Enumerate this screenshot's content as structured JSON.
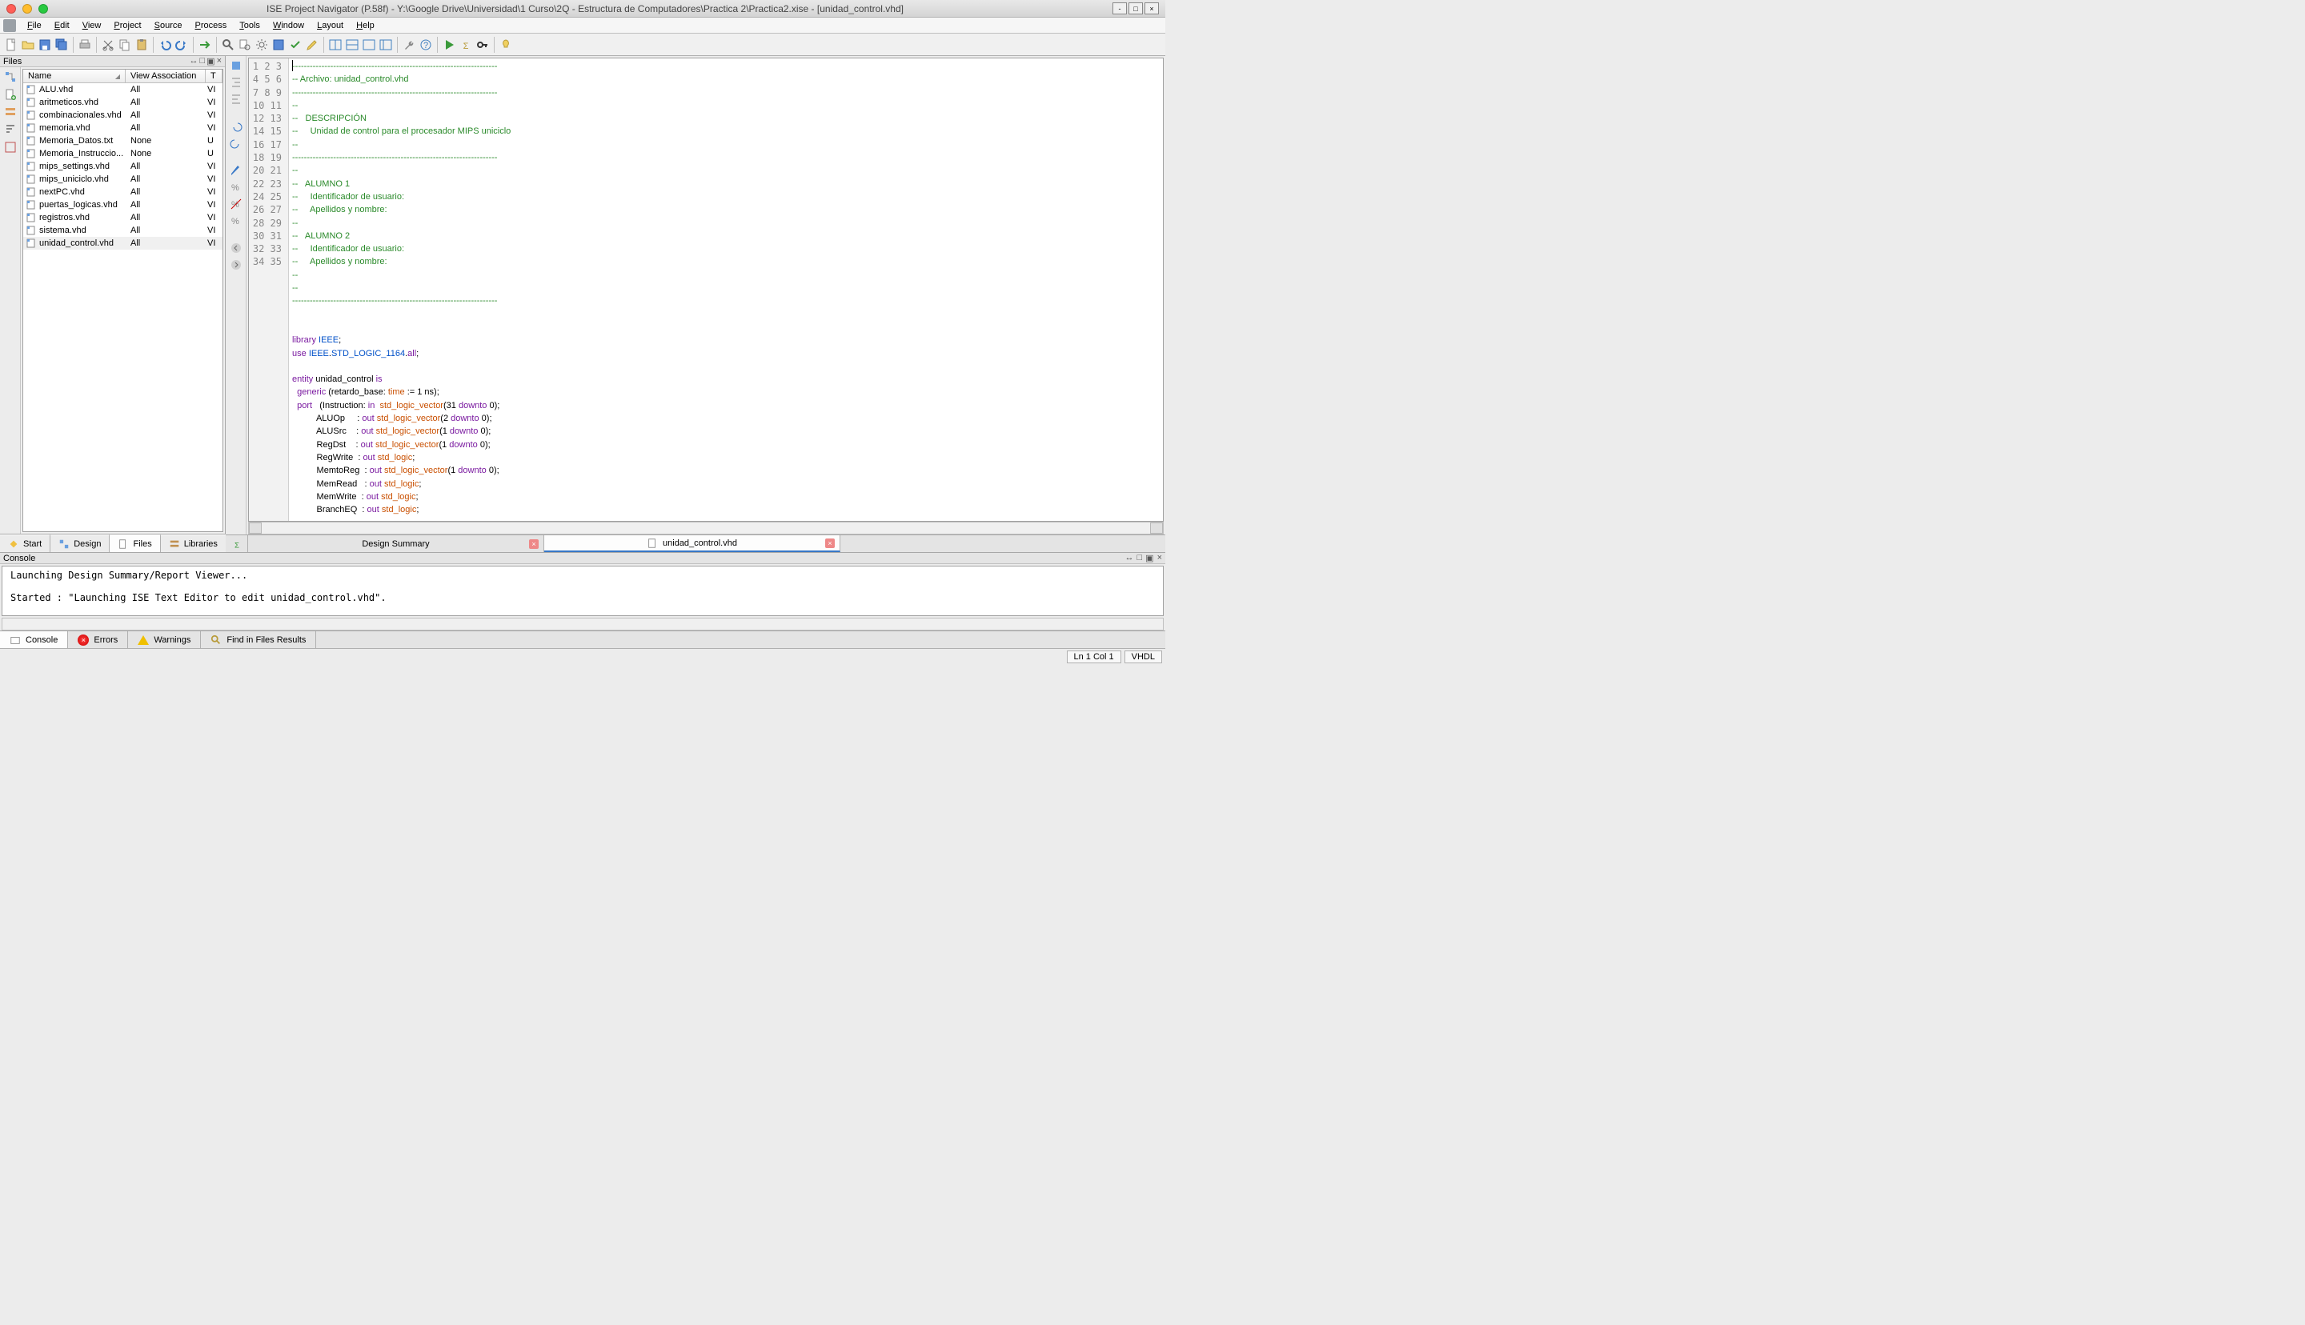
{
  "title": "ISE Project Navigator (P.58f) - Y:\\Google Drive\\Universidad\\1 Curso\\2Q - Estructura de Computadores\\Practica 2\\Practica2.xise - [unidad_control.vhd]",
  "menubar": [
    "File",
    "Edit",
    "View",
    "Project",
    "Source",
    "Process",
    "Tools",
    "Window",
    "Layout",
    "Help"
  ],
  "files_panel": {
    "title": "Files",
    "columns": [
      "Name",
      "View Association",
      "T"
    ],
    "rows": [
      {
        "name": "ALU.vhd",
        "assoc": "All",
        "t": "VI",
        "sel": false
      },
      {
        "name": "aritmeticos.vhd",
        "assoc": "All",
        "t": "VI",
        "sel": false
      },
      {
        "name": "combinacionales.vhd",
        "assoc": "All",
        "t": "VI",
        "sel": false
      },
      {
        "name": "memoria.vhd",
        "assoc": "All",
        "t": "VI",
        "sel": false
      },
      {
        "name": "Memoria_Datos.txt",
        "assoc": "None",
        "t": "U",
        "sel": false
      },
      {
        "name": "Memoria_Instruccio...",
        "assoc": "None",
        "t": "U",
        "sel": false
      },
      {
        "name": "mips_settings.vhd",
        "assoc": "All",
        "t": "VI",
        "sel": false
      },
      {
        "name": "mips_uniciclo.vhd",
        "assoc": "All",
        "t": "VI",
        "sel": false
      },
      {
        "name": "nextPC.vhd",
        "assoc": "All",
        "t": "VI",
        "sel": false
      },
      {
        "name": "puertas_logicas.vhd",
        "assoc": "All",
        "t": "VI",
        "sel": false
      },
      {
        "name": "registros.vhd",
        "assoc": "All",
        "t": "VI",
        "sel": false
      },
      {
        "name": "sistema.vhd",
        "assoc": "All",
        "t": "VI",
        "sel": false
      },
      {
        "name": "unidad_control.vhd",
        "assoc": "All",
        "t": "VI",
        "sel": true
      }
    ]
  },
  "side_tabs": [
    "Start",
    "Design",
    "Files",
    "Libraries"
  ],
  "side_tabs_active": 2,
  "editor": {
    "lines": [
      {
        "n": 1,
        "html": "<span class='c-cmt'>----------------------------------------------------------------------</span>"
      },
      {
        "n": 2,
        "html": "<span class='c-cmt'>-- Archivo: unidad_control.vhd</span>"
      },
      {
        "n": 3,
        "html": "<span class='c-cmt'>----------------------------------------------------------------------</span>"
      },
      {
        "n": 4,
        "html": "<span class='c-cmt'>--</span>"
      },
      {
        "n": 5,
        "html": "<span class='c-cmt'>--   DESCRIPCIÓN</span>"
      },
      {
        "n": 6,
        "html": "<span class='c-cmt'>--     Unidad de control para el procesador MIPS uniciclo</span>"
      },
      {
        "n": 7,
        "html": "<span class='c-cmt'>--</span>"
      },
      {
        "n": 8,
        "html": "<span class='c-cmt'>----------------------------------------------------------------------</span>"
      },
      {
        "n": 9,
        "html": "<span class='c-cmt'>--</span>"
      },
      {
        "n": 10,
        "html": "<span class='c-cmt'>--   ALUMNO 1</span>"
      },
      {
        "n": 11,
        "html": "<span class='c-cmt'>--     Identificador de usuario:</span>"
      },
      {
        "n": 12,
        "html": "<span class='c-cmt'>--     Apellidos y nombre:</span>"
      },
      {
        "n": 13,
        "html": "<span class='c-cmt'>--</span>"
      },
      {
        "n": 14,
        "html": "<span class='c-cmt'>--   ALUMNO 2</span>"
      },
      {
        "n": 15,
        "html": "<span class='c-cmt'>--     Identificador de usuario:</span>"
      },
      {
        "n": 16,
        "html": "<span class='c-cmt'>--     Apellidos y nombre:</span>"
      },
      {
        "n": 17,
        "html": "<span class='c-cmt'>--</span>"
      },
      {
        "n": 18,
        "html": "<span class='c-cmt'>--</span>"
      },
      {
        "n": 19,
        "html": "<span class='c-cmt'>----------------------------------------------------------------------</span>"
      },
      {
        "n": 20,
        "html": ""
      },
      {
        "n": 21,
        "html": ""
      },
      {
        "n": 22,
        "html": "<span class='c-kw'>library</span> <span class='c-lib'>IEEE</span>;"
      },
      {
        "n": 23,
        "html": "<span class='c-kw'>use</span> <span class='c-lib'>IEEE</span>.<span class='c-lib'>STD_LOGIC_1164</span>.<span class='c-kw'>all</span>;"
      },
      {
        "n": 24,
        "html": ""
      },
      {
        "n": 25,
        "html": "<span class='c-kw'>entity</span> unidad_control <span class='c-kw'>is</span>"
      },
      {
        "n": 26,
        "html": "  <span class='c-kw'>generic</span> (retardo_base: <span class='c-type'>time</span> := 1 ns);"
      },
      {
        "n": 27,
        "html": "  <span class='c-kw'>port</span>   (Instruction: <span class='c-kw'>in</span>  <span class='c-type'>std_logic_vector</span>(31 <span class='c-kw'>downto</span> 0);"
      },
      {
        "n": 28,
        "html": "          ALUOp     : <span class='c-kw'>out</span> <span class='c-type'>std_logic_vector</span>(2 <span class='c-kw'>downto</span> 0);"
      },
      {
        "n": 29,
        "html": "          ALUSrc    : <span class='c-kw'>out</span> <span class='c-type'>std_logic_vector</span>(1 <span class='c-kw'>downto</span> 0);"
      },
      {
        "n": 30,
        "html": "          RegDst    : <span class='c-kw'>out</span> <span class='c-type'>std_logic_vector</span>(1 <span class='c-kw'>downto</span> 0);"
      },
      {
        "n": 31,
        "html": "          RegWrite  : <span class='c-kw'>out</span> <span class='c-type'>std_logic</span>;"
      },
      {
        "n": 32,
        "html": "          MemtoReg  : <span class='c-kw'>out</span> <span class='c-type'>std_logic_vector</span>(1 <span class='c-kw'>downto</span> 0);"
      },
      {
        "n": 33,
        "html": "          MemRead   : <span class='c-kw'>out</span> <span class='c-type'>std_logic</span>;"
      },
      {
        "n": 34,
        "html": "          MemWrite  : <span class='c-kw'>out</span> <span class='c-type'>std_logic</span>;"
      },
      {
        "n": 35,
        "html": "          BranchEQ  : <span class='c-kw'>out</span> <span class='c-type'>std_logic</span>;"
      }
    ],
    "tabs": [
      {
        "label": "Design Summary",
        "active": false,
        "closable": true
      },
      {
        "label": "unidad_control.vhd",
        "active": true,
        "closable": true
      }
    ]
  },
  "console": {
    "title": "Console",
    "text": "Launching Design Summary/Report Viewer...\n\nStarted : \"Launching ISE Text Editor to edit unidad_control.vhd\".\n",
    "tabs": [
      "Console",
      "Errors",
      "Warnings",
      "Find in Files Results"
    ],
    "tabs_active": 0
  },
  "status": {
    "pos": "Ln 1 Col 1",
    "lang": "VHDL"
  }
}
